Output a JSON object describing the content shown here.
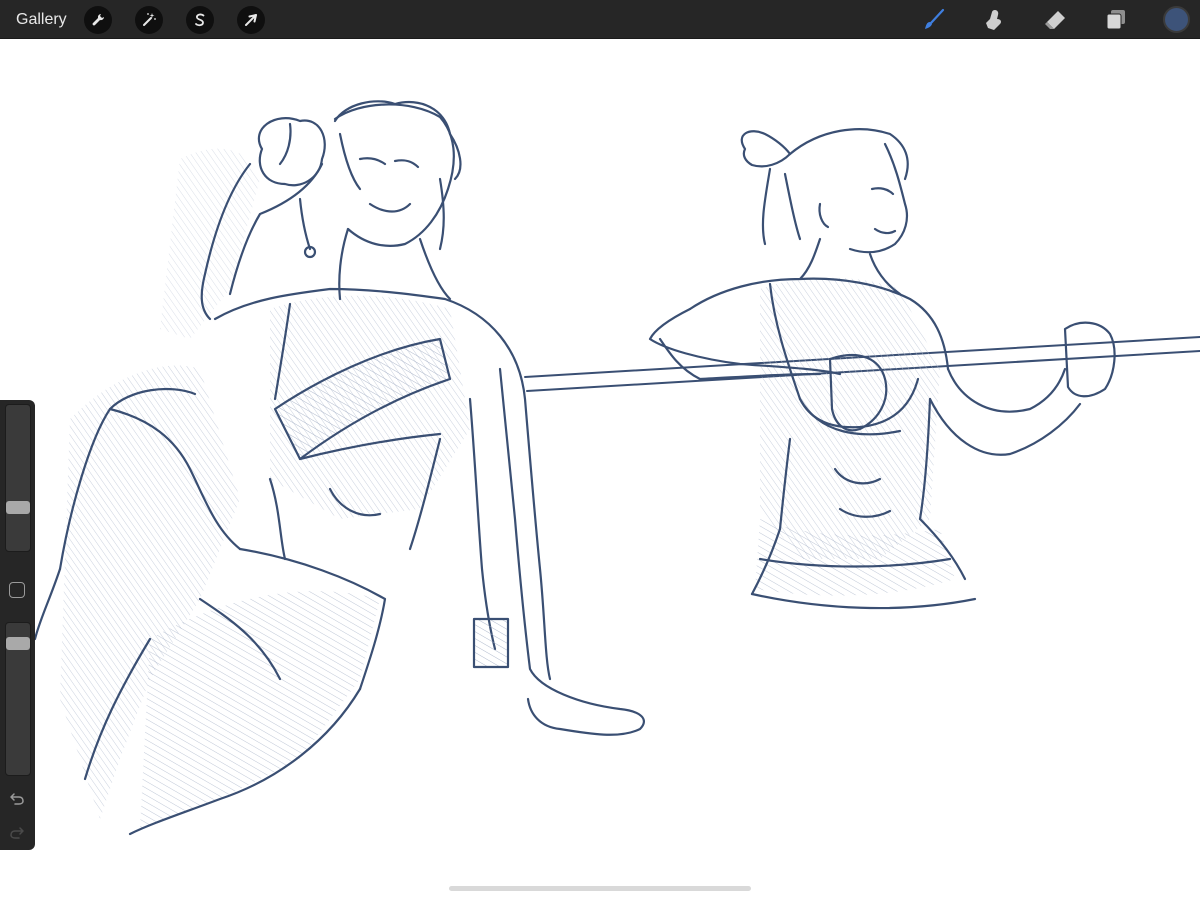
{
  "toolbar": {
    "gallery_label": "Gallery",
    "left_tools": [
      {
        "name": "actions",
        "icon": "wrench-icon"
      },
      {
        "name": "adjustments",
        "icon": "magic-wand-icon"
      },
      {
        "name": "selection",
        "icon": "selection-s-icon"
      },
      {
        "name": "transform",
        "icon": "arrow-cursor-icon"
      }
    ],
    "right_tools": [
      {
        "name": "brush",
        "icon": "brush-icon",
        "active": true
      },
      {
        "name": "smudge",
        "icon": "smudge-icon"
      },
      {
        "name": "eraser",
        "icon": "eraser-icon"
      },
      {
        "name": "layers",
        "icon": "layers-icon"
      }
    ],
    "current_color": "#3d5379",
    "active_tool_color": "#3f7fe0"
  },
  "sidebar": {
    "brush_size_level": 0.28,
    "opacity_level": 0.9,
    "icons": [
      "square-modify-icon",
      "undo-icon",
      "redo-icon"
    ]
  },
  "canvas": {
    "stroke_color": "#3a4f73"
  }
}
